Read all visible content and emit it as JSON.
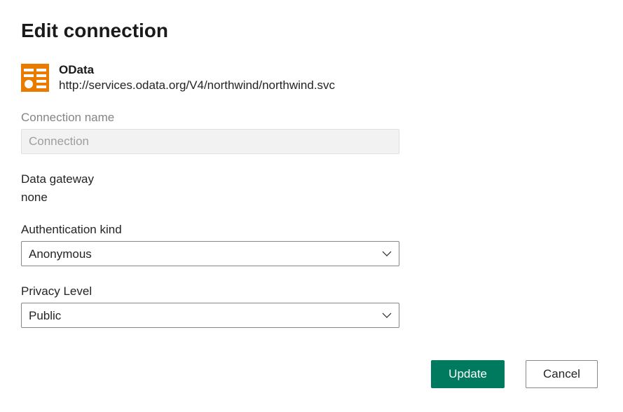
{
  "title": "Edit connection",
  "connection": {
    "type": "OData",
    "url": "http://services.odata.org/V4/northwind/northwind.svc"
  },
  "fields": {
    "connection_name": {
      "label": "Connection name",
      "placeholder": "Connection",
      "value": ""
    },
    "data_gateway": {
      "label": "Data gateway",
      "value": "none"
    },
    "authentication_kind": {
      "label": "Authentication kind",
      "value": "Anonymous"
    },
    "privacy_level": {
      "label": "Privacy Level",
      "value": "Public"
    }
  },
  "buttons": {
    "update": "Update",
    "cancel": "Cancel"
  },
  "icons": {
    "data_source": "odata-icon",
    "chevron": "chevron-down-icon"
  }
}
